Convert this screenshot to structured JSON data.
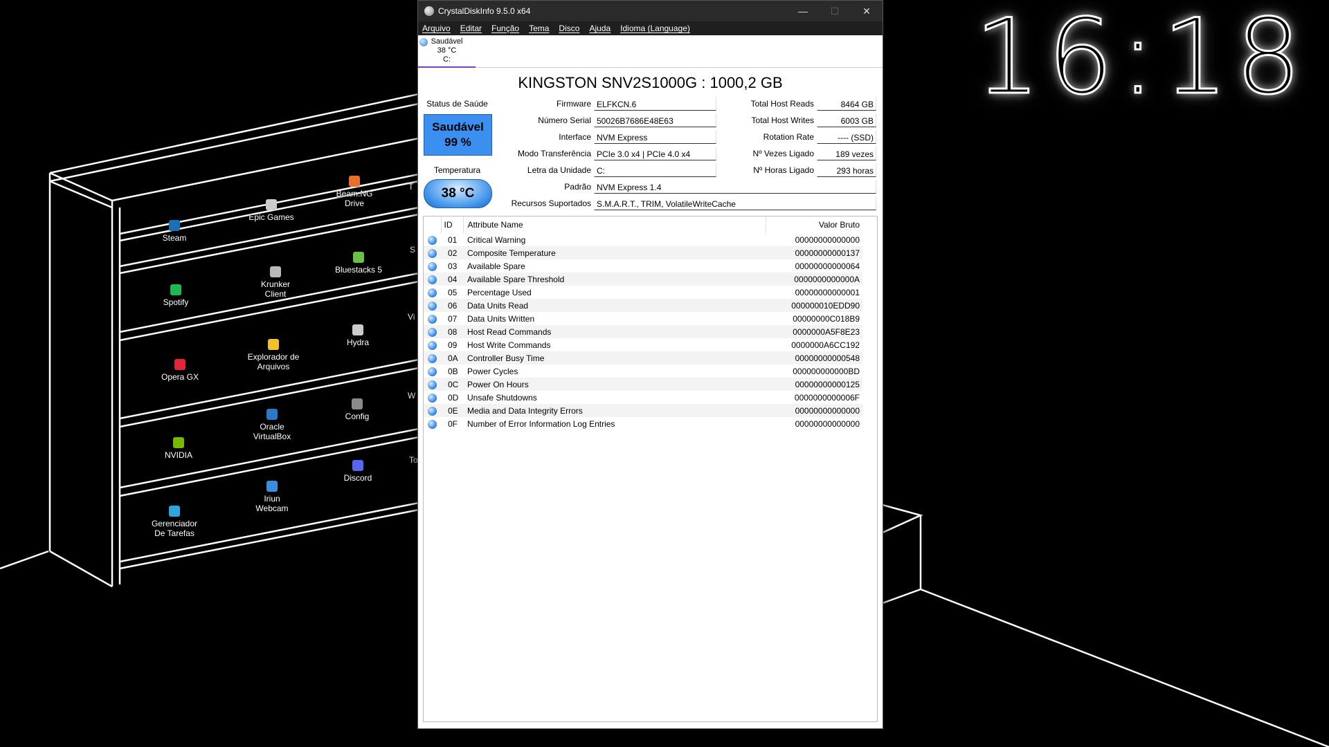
{
  "desktop": {
    "clock": "16:18",
    "icons": [
      {
        "label": "Steam",
        "color": "#1b6fb5"
      },
      {
        "label": "Epic Games",
        "color": "#cccccc"
      },
      {
        "label": "Beam.NG Drive",
        "color": "#e86f2a"
      },
      {
        "label": "Spotify",
        "color": "#1db954"
      },
      {
        "label": "Krunker Client",
        "color": "#b9b9b9"
      },
      {
        "label": "Bluestacks 5",
        "color": "#6cc04a"
      },
      {
        "label": "Opera GX",
        "color": "#e0243a"
      },
      {
        "label": "Explorador de Arquivos",
        "color": "#f2c029"
      },
      {
        "label": "Hydra",
        "color": "#cccccc"
      },
      {
        "label": "Oracle VirtualBox",
        "color": "#2a78c8"
      },
      {
        "label": "Config",
        "color": "#8a8a8a"
      },
      {
        "label": "NVIDIA",
        "color": "#76b900"
      },
      {
        "label": "Discord",
        "color": "#5865f2"
      },
      {
        "label": "Iriun Webcam",
        "color": "#3a8ee0"
      },
      {
        "label": "Gerenciador De Tarefas",
        "color": "#2fa5e0"
      }
    ],
    "partial_labels": [
      "T",
      "S",
      "Vi",
      "W",
      "To"
    ]
  },
  "window": {
    "title": "CrystalDiskInfo 9.5.0 x64",
    "menu": [
      "Arquivo",
      "Editar",
      "Função",
      "Tema",
      "Disco",
      "Ajuda",
      "Idioma (Language)"
    ],
    "disk_tab": {
      "status": "Saudável",
      "temp": "38 °C",
      "letter": "C:"
    },
    "drive_title": "KINGSTON SNV2S1000G : 1000,2 GB",
    "health": {
      "label": "Status de Saúde",
      "status": "Saudável",
      "percent": "99 %",
      "color": "#3a8ff0"
    },
    "temperature": {
      "label": "Temperatura",
      "value": "38 °C"
    },
    "info": {
      "firmware": {
        "label": "Firmware",
        "value": "ELFKCN.6"
      },
      "serial": {
        "label": "Número Serial",
        "value": "50026B7686E48E63"
      },
      "interface": {
        "label": "Interface",
        "value": "NVM Express"
      },
      "transfer": {
        "label": "Modo Transferência",
        "value": "PCIe 3.0 x4 | PCIe 4.0 x4"
      },
      "drive_letter": {
        "label": "Letra da Unidade",
        "value": "C:"
      },
      "standard": {
        "label": "Padrão",
        "value": "NVM Express 1.4"
      },
      "features": {
        "label": "Recursos Suportados",
        "value": "S.M.A.R.T., TRIM, VolatileWriteCache"
      },
      "host_reads": {
        "label": "Total Host Reads",
        "value": "8464 GB"
      },
      "host_writes": {
        "label": "Total Host Writes",
        "value": "6003 GB"
      },
      "rotation": {
        "label": "Rotation Rate",
        "value": "---- (SSD)"
      },
      "power_count": {
        "label": "Nº Vezes Ligado",
        "value": "189 vezes"
      },
      "power_hours": {
        "label": "Nº Horas Ligado",
        "value": "293 horas"
      }
    },
    "smart": {
      "headers": {
        "id": "ID",
        "name": "Attribute Name",
        "raw": "Valor Bruto"
      },
      "rows": [
        {
          "id": "01",
          "name": "Critical Warning",
          "raw": "00000000000000"
        },
        {
          "id": "02",
          "name": "Composite Temperature",
          "raw": "00000000000137"
        },
        {
          "id": "03",
          "name": "Available Spare",
          "raw": "00000000000064"
        },
        {
          "id": "04",
          "name": "Available Spare Threshold",
          "raw": "0000000000000A"
        },
        {
          "id": "05",
          "name": "Percentage Used",
          "raw": "00000000000001"
        },
        {
          "id": "06",
          "name": "Data Units Read",
          "raw": "000000010EDD90"
        },
        {
          "id": "07",
          "name": "Data Units Written",
          "raw": "00000000C018B9"
        },
        {
          "id": "08",
          "name": "Host Read Commands",
          "raw": "0000000A5F8E23"
        },
        {
          "id": "09",
          "name": "Host Write Commands",
          "raw": "0000000A6CC192"
        },
        {
          "id": "0A",
          "name": "Controller Busy Time",
          "raw": "00000000000548"
        },
        {
          "id": "0B",
          "name": "Power Cycles",
          "raw": "000000000000BD"
        },
        {
          "id": "0C",
          "name": "Power On Hours",
          "raw": "00000000000125"
        },
        {
          "id": "0D",
          "name": "Unsafe Shutdowns",
          "raw": "0000000000006F"
        },
        {
          "id": "0E",
          "name": "Media and Data Integrity Errors",
          "raw": "00000000000000"
        },
        {
          "id": "0F",
          "name": "Number of Error Information Log Entries",
          "raw": "00000000000000"
        }
      ]
    }
  }
}
